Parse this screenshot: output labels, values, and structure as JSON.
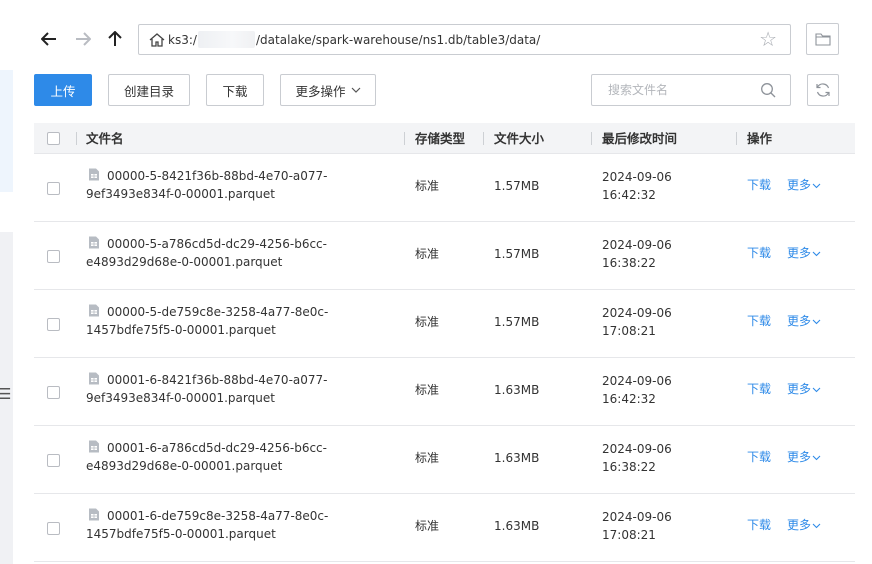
{
  "nav": {
    "back_glyph": "←",
    "forward_glyph": "→",
    "up_glyph": "↑",
    "path_prefix": "ks3:/",
    "path_rest": "/datalake/spark-warehouse/ns1.db/table3/data/",
    "star_glyph": "☆"
  },
  "toolbar": {
    "upload": "上传",
    "mkdir": "创建目录",
    "download": "下载",
    "more_ops": "更多操作",
    "search_placeholder": "搜索文件名"
  },
  "table": {
    "headers": {
      "name": "文件名",
      "storage": "存储类型",
      "size": "文件大小",
      "modified": "最后修改时间",
      "actions": "操作"
    },
    "rows": [
      {
        "name_line1": "00000-5-8421f36b-88bd-4e70-a077-",
        "name_line2": "9ef3493e834f-0-00001.parquet",
        "storage": "标准",
        "size": "1.57MB",
        "date": "2024-09-06",
        "time": "16:42:32",
        "download": "下载",
        "more": "更多"
      },
      {
        "name_line1": "00000-5-a786cd5d-dc29-4256-b6cc-",
        "name_line2": "e4893d29d68e-0-00001.parquet",
        "storage": "标准",
        "size": "1.57MB",
        "date": "2024-09-06",
        "time": "16:38:22",
        "download": "下载",
        "more": "更多"
      },
      {
        "name_line1": "00000-5-de759c8e-3258-4a77-8e0c-",
        "name_line2": "1457bdfe75f5-0-00001.parquet",
        "storage": "标准",
        "size": "1.57MB",
        "date": "2024-09-06",
        "time": "17:08:21",
        "download": "下载",
        "more": "更多"
      },
      {
        "name_line1": "00001-6-8421f36b-88bd-4e70-a077-",
        "name_line2": "9ef3493e834f-0-00001.parquet",
        "storage": "标准",
        "size": "1.63MB",
        "date": "2024-09-06",
        "time": "16:42:32",
        "download": "下载",
        "more": "更多"
      },
      {
        "name_line1": "00001-6-a786cd5d-dc29-4256-b6cc-",
        "name_line2": "e4893d29d68e-0-00001.parquet",
        "storage": "标准",
        "size": "1.63MB",
        "date": "2024-09-06",
        "time": "16:38:22",
        "download": "下载",
        "more": "更多"
      },
      {
        "name_line1": "00001-6-de759c8e-3258-4a77-8e0c-",
        "name_line2": "1457bdfe75f5-0-00001.parquet",
        "storage": "标准",
        "size": "1.63MB",
        "date": "2024-09-06",
        "time": "17:08:21",
        "download": "下载",
        "more": "更多"
      }
    ]
  },
  "colors": {
    "primary": "#2e8ae8",
    "header_bg": "#f3f4f6",
    "border": "#c9ccd1"
  },
  "icons": {
    "back": "arrow-left-icon",
    "forward": "arrow-right-icon",
    "up": "arrow-up-icon",
    "home": "home-icon",
    "star": "star-icon",
    "folder": "folder-icon",
    "search": "search-icon",
    "refresh": "refresh-icon",
    "file": "file-icon",
    "chevron": "chevron-down-icon"
  }
}
